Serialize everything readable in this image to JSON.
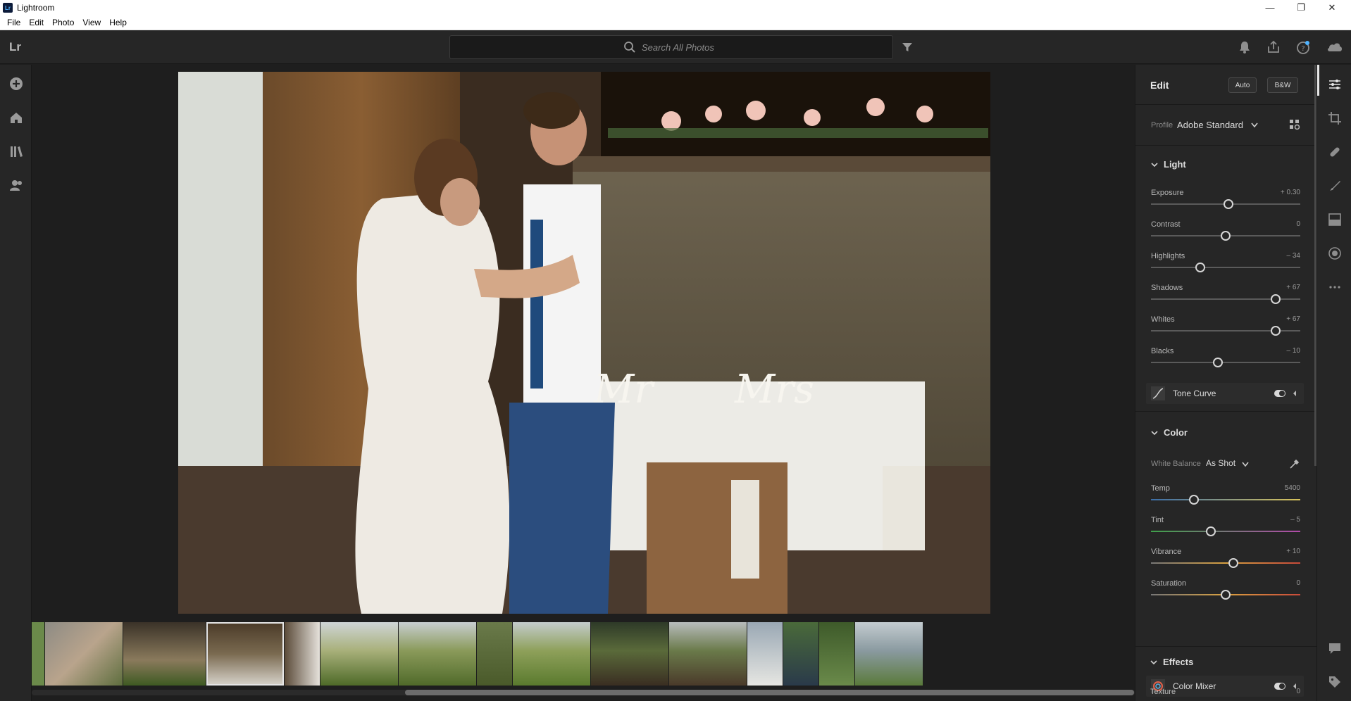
{
  "window": {
    "title": "Lightroom",
    "app_icon_text": "Lr",
    "minimize": "—",
    "restore": "❐",
    "close": "✕"
  },
  "menu": {
    "items": [
      "File",
      "Edit",
      "Photo",
      "View",
      "Help"
    ]
  },
  "header": {
    "logo": "Lr",
    "search_placeholder": "Search All Photos"
  },
  "edit": {
    "title": "Edit",
    "auto_label": "Auto",
    "bw_label": "B&W",
    "profile_label": "Profile",
    "profile_value": "Adobe Standard",
    "light": {
      "title": "Light",
      "sliders": [
        {
          "label": "Exposure",
          "value": "+ 0.30",
          "pos": 0.52
        },
        {
          "label": "Contrast",
          "value": "0",
          "pos": 0.5
        },
        {
          "label": "Highlights",
          "value": "– 34",
          "pos": 0.33
        },
        {
          "label": "Shadows",
          "value": "+ 67",
          "pos": 0.835
        },
        {
          "label": "Whites",
          "value": "+ 67",
          "pos": 0.835
        },
        {
          "label": "Blacks",
          "value": "– 10",
          "pos": 0.45
        }
      ]
    },
    "tone_curve": "Tone Curve",
    "color": {
      "title": "Color",
      "wb_label": "White Balance",
      "wb_value": "As Shot",
      "sliders": [
        {
          "label": "Temp",
          "value": "5400",
          "pos": 0.29
        },
        {
          "label": "Tint",
          "value": "– 5",
          "pos": 0.4
        },
        {
          "label": "Vibrance",
          "value": "+ 10",
          "pos": 0.55
        },
        {
          "label": "Saturation",
          "value": "0",
          "pos": 0.5
        }
      ]
    },
    "color_mixer": "Color Mixer",
    "effects": {
      "title": "Effects",
      "sliders": [
        {
          "label": "Texture",
          "value": "0",
          "pos": 0.5
        }
      ]
    }
  },
  "colors": {
    "accent": "#4fb3ff",
    "panel": "#262626",
    "canvas": "#1e1e1e"
  }
}
